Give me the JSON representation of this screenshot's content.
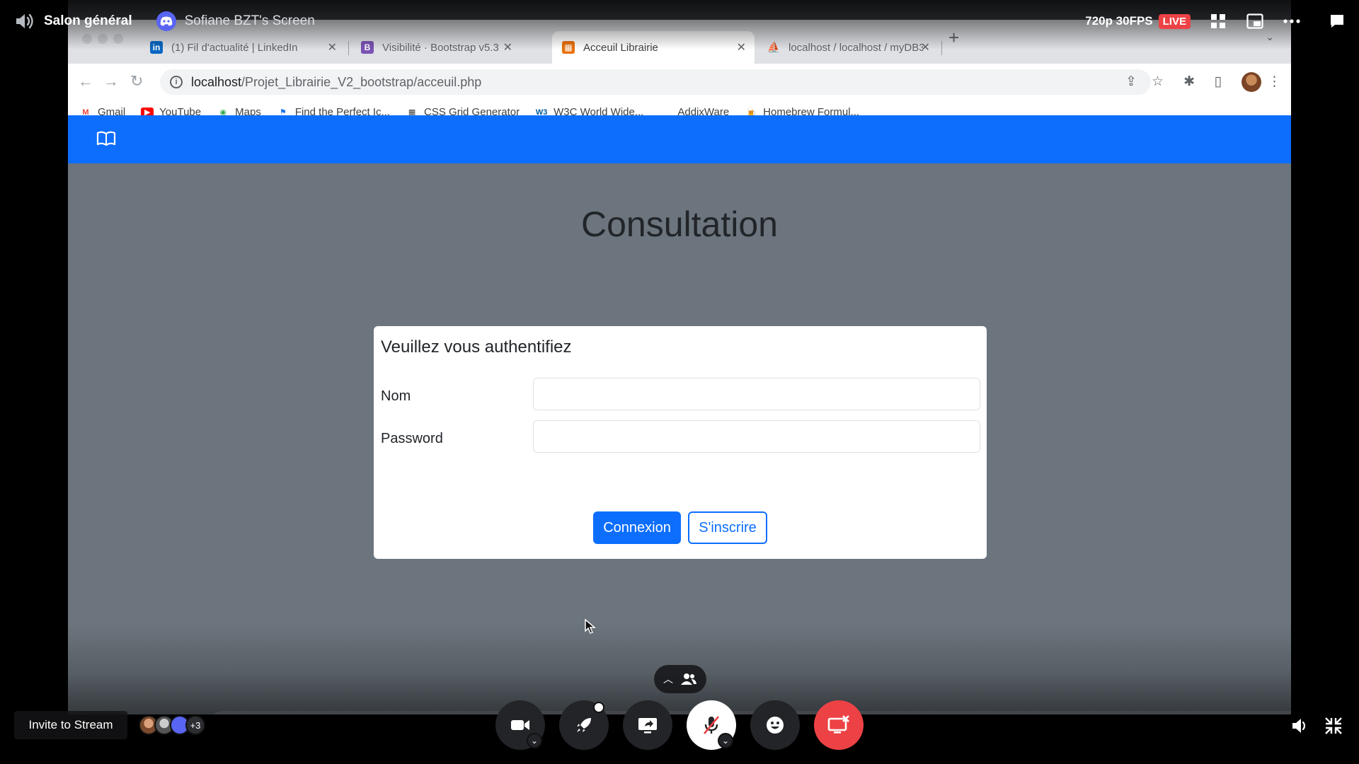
{
  "discord": {
    "channel_name": "Salon général",
    "stream_title": "Sofiane BZT's Screen",
    "quality": "720p 30FPS",
    "live_label": "LIVE",
    "invite_label": "Invite to Stream",
    "extra_viewers": "+3",
    "dock_label": "Sofiane BZT"
  },
  "browser": {
    "tabs": [
      {
        "label": "(1) Fil d'actualité | LinkedIn",
        "favicon": "in",
        "color": "#0a66c2"
      },
      {
        "label": "Visibilité · Bootstrap v5.3",
        "favicon": "B",
        "color": "#7952b3"
      },
      {
        "label": "Acceuil Librairie",
        "favicon": "▦",
        "color": "#e8710a"
      },
      {
        "label": "localhost / localhost / myDB3 /",
        "favicon": "⛵",
        "color": "#f29111"
      }
    ],
    "url_host": "localhost",
    "url_path": "/Projet_Librairie_V2_bootstrap/acceuil.php",
    "bookmarks": [
      {
        "label": "Gmail",
        "icon": "M",
        "color": "#ea4335"
      },
      {
        "label": "YouTube",
        "icon": "▶",
        "color": "#ff0000"
      },
      {
        "label": "Maps",
        "icon": "◉",
        "color": "#34a853"
      },
      {
        "label": "Find the Perfect Ic...",
        "icon": "⚑",
        "color": "#1a73e8"
      },
      {
        "label": "CSS Grid Generator",
        "icon": "▦",
        "color": "#3c4043"
      },
      {
        "label": "W3C World Wide...",
        "icon": "W3",
        "color": "#005a9c"
      },
      {
        "label": "AddixWare",
        "icon": "",
        "color": "#ffffff"
      },
      {
        "label": "Homebrew Formul...",
        "icon": "🍺",
        "color": "#f9d094"
      }
    ]
  },
  "site": {
    "page_title": "Consultation",
    "auth_title": "Veuillez vous authentifiez",
    "name_label": "Nom",
    "password_label": "Password",
    "name_value": "",
    "password_value": "",
    "login_button": "Connexion",
    "register_button": "S'inscrire",
    "brand_color": "#0d6efd"
  },
  "icons": {
    "channel": "speaker-icon",
    "stream": "discord-logo-icon",
    "grid": "grid-icon",
    "popout": "popout-icon",
    "more": "more-icon",
    "chat": "chat-icon"
  }
}
